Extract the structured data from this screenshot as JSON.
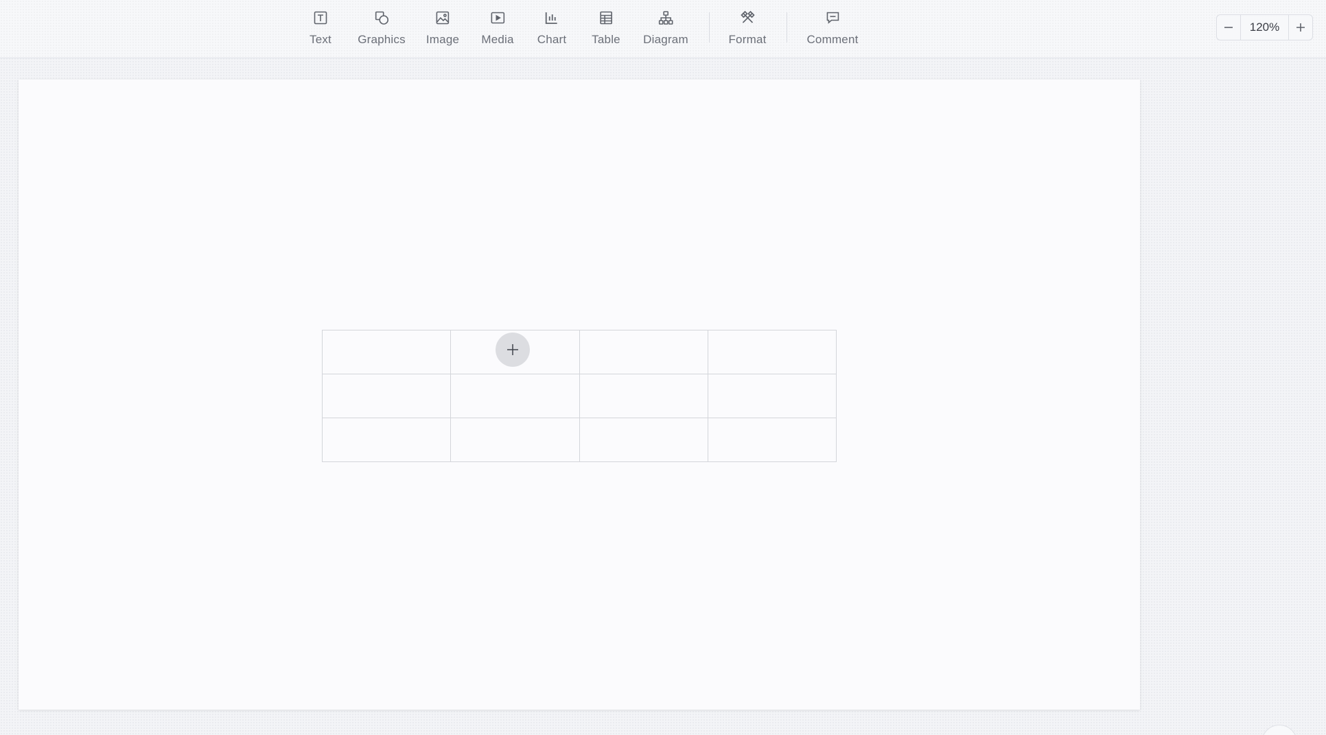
{
  "toolbar": {
    "tools": [
      {
        "label": "Text",
        "icon": "text-box-icon"
      },
      {
        "label": "Graphics",
        "icon": "shapes-icon"
      },
      {
        "label": "Image",
        "icon": "image-icon"
      },
      {
        "label": "Media",
        "icon": "media-play-icon"
      },
      {
        "label": "Chart",
        "icon": "bar-chart-icon"
      },
      {
        "label": "Table",
        "icon": "table-icon"
      },
      {
        "label": "Diagram",
        "icon": "org-diagram-icon"
      },
      {
        "label": "Format",
        "icon": "format-tools-icon"
      },
      {
        "label": "Comment",
        "icon": "comment-icon"
      }
    ]
  },
  "zoom": {
    "value": "120%",
    "decrease_icon": "minus-icon",
    "increase_icon": "plus-icon"
  },
  "slide": {
    "table": {
      "rows": 3,
      "columns": 4,
      "cells": [
        [
          "",
          "",
          "",
          ""
        ],
        [
          "",
          "",
          "",
          ""
        ],
        [
          "",
          "",
          "",
          ""
        ]
      ]
    },
    "add_button_icon": "plus-icon"
  },
  "colors": {
    "toolbar_text": "#6b6f78",
    "icon_stroke": "#5f636b",
    "slide_background": "#fbfbfd",
    "table_border": "#d3d5da",
    "add_button_background": "#dcdde1"
  }
}
